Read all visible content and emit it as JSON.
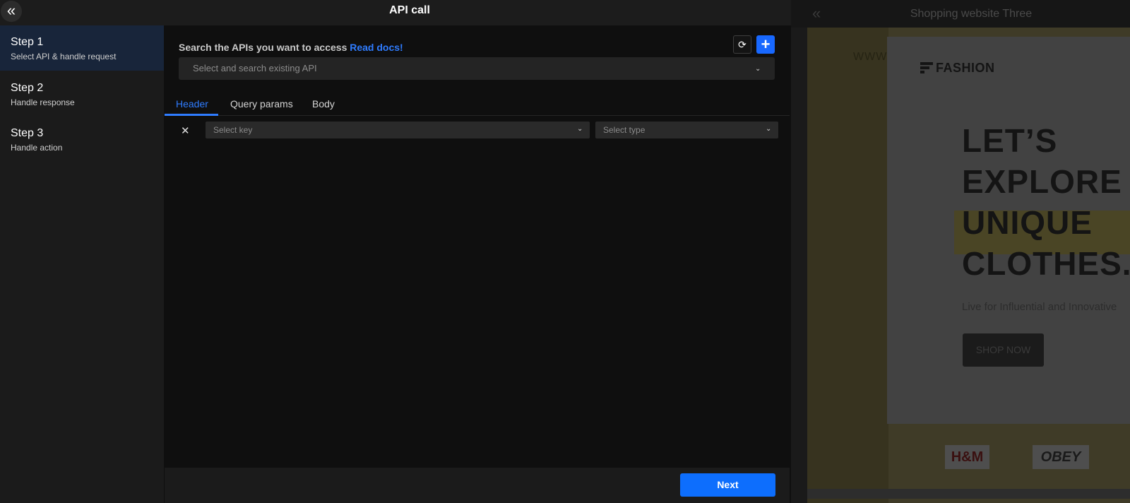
{
  "header": {
    "title": "API call"
  },
  "steps": [
    {
      "title": "Step 1",
      "subtitle": "Select API & handle request"
    },
    {
      "title": "Step 2",
      "subtitle": "Handle response"
    },
    {
      "title": "Step 3",
      "subtitle": "Handle action"
    }
  ],
  "api_search": {
    "label": "Search the APIs you want to access",
    "docs_link": "Read docs!",
    "placeholder": "Select and search existing API"
  },
  "tabs": [
    {
      "label": "Header",
      "active": true
    },
    {
      "label": "Query params",
      "active": false
    },
    {
      "label": "Body",
      "active": false
    }
  ],
  "header_row": {
    "key_placeholder": "Select key",
    "type_placeholder": "Select type"
  },
  "footer": {
    "next_label": "Next"
  },
  "preview": {
    "title": "Shopping website Three",
    "url_fragment": "WWW",
    "logo": "FASHION",
    "headline_lines": [
      "LET’S",
      "EXPLORE",
      "UNIQUE",
      "CLOTHES."
    ],
    "subtitle": "Live for Influential and Innovative",
    "cta": "SHOP NOW",
    "brands": [
      "H&M",
      "OBEY"
    ]
  },
  "colors": {
    "accent": "#1868ff",
    "active_step_bg": "#18253a",
    "link": "#2f7cff"
  },
  "icons": {
    "back": "double-chevron-left-icon",
    "refresh": "refresh-icon",
    "add": "plus-icon",
    "remove": "close-icon",
    "dropdown": "chevron-down-icon"
  }
}
